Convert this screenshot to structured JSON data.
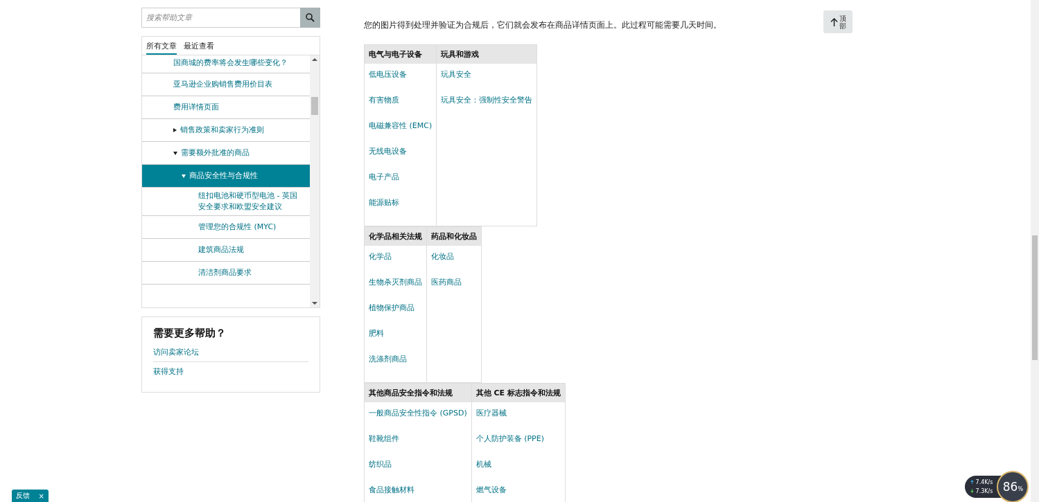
{
  "sidebar": {
    "search": {
      "placeholder": "搜索帮助文章"
    },
    "tabs": [
      {
        "label": "所有文章",
        "selected": true
      },
      {
        "label": "最近查看",
        "selected": false
      }
    ],
    "tree": [
      {
        "label": "国商城的费率将会发生哪些变化？"
      },
      {
        "label": "亚马逊企业购销售费用价目表"
      },
      {
        "label": "费用详情页面"
      },
      {
        "label": "销售政策和卖家行为准则",
        "expanded": false,
        "selected": false
      },
      {
        "label": "需要额外批准的商品",
        "expanded": true,
        "selected": false,
        "children": [
          {
            "label": "商品安全性与合规性",
            "expanded": true,
            "selected": true,
            "children": [
              {
                "label": "纽扣电池和硬币型电池 - 英国安全要求和欧盟安全建议"
              },
              {
                "label": "管理您的合规性 (MYC)"
              },
              {
                "label": "建筑商品法规"
              },
              {
                "label": "清洁剂商品要求"
              }
            ]
          }
        ]
      }
    ],
    "help": {
      "title": "需要更多帮助？",
      "links": [
        "访问卖家论坛",
        "获得支持"
      ]
    }
  },
  "content": {
    "intro": "您的图片得到处理并验证为合规后，它们就会发布在商品详情页面上。此过程可能需要几天时间。",
    "tables": [
      {
        "columns": [
          {
            "header": "电气与电子设备",
            "links": [
              "低电压设备",
              "有害物质",
              "电磁兼容性 (EMC)",
              "无线电设备",
              "电子产品",
              "能源贴标"
            ]
          },
          {
            "header": "玩具和游戏",
            "links": [
              "玩具安全",
              "玩具安全：强制性安全警告"
            ]
          }
        ]
      },
      {
        "columns": [
          {
            "header": "化学品相关法规",
            "links": [
              "化学品",
              "生物杀灭剂商品",
              "植物保护商品",
              "肥料",
              "洗涤剂商品"
            ]
          },
          {
            "header": "药品和化妆品",
            "links": [
              "化妆品",
              "医药商品"
            ]
          }
        ]
      },
      {
        "columns": [
          {
            "header": "其他商品安全指令和法规",
            "links": [
              "一般商品安全性指令 (GPSD)",
              "鞋靴组件",
              "纺织品",
              "食品接触材料"
            ]
          },
          {
            "header": "其他 CE 标志指令和法规",
            "links": [
              "医疗器械",
              "个人防护装备 (PPE)",
              "机械",
              "燃气设备"
            ]
          }
        ]
      }
    ],
    "back_to_top": {
      "label": "顶部"
    }
  },
  "feedback": {
    "label": "反馈",
    "close": "×"
  },
  "net_monitor": {
    "upload": "7.4K/s",
    "download": "7.3K/s",
    "value": "86",
    "unit": "%"
  }
}
